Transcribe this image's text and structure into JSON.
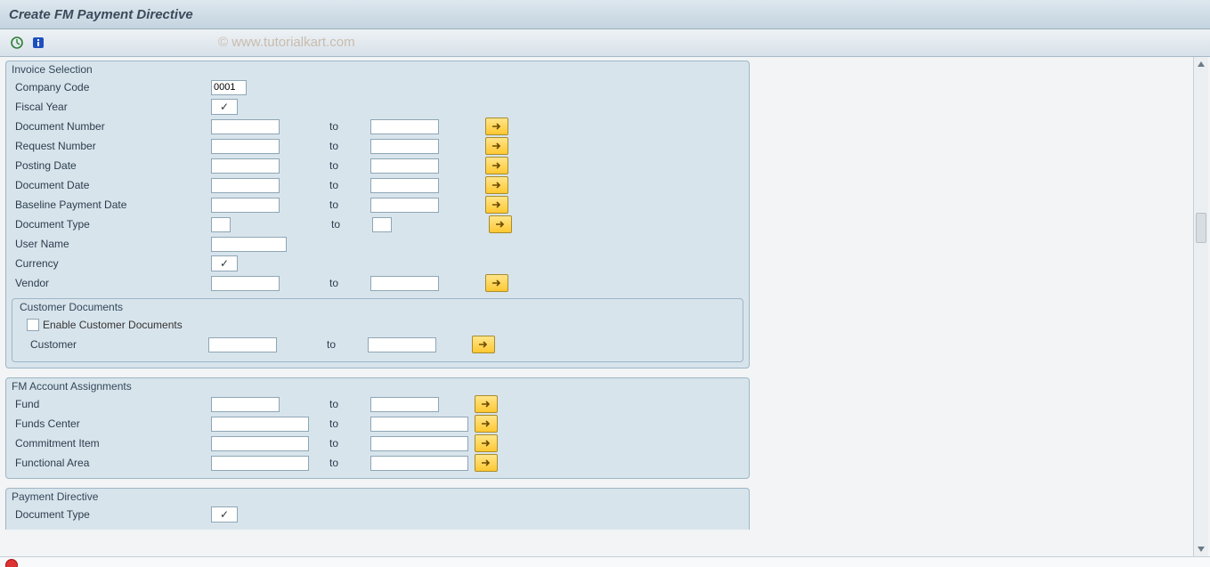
{
  "title": "Create FM Payment Directive",
  "watermark": "© www.tutorialkart.com",
  "toolbar": {
    "execute_icon": "execute-icon",
    "info_icon": "info-icon"
  },
  "groups": {
    "invoice_selection": {
      "title": "Invoice Selection",
      "fields": {
        "company_code": {
          "label": "Company Code",
          "value": "0001"
        },
        "fiscal_year": {
          "label": "Fiscal Year",
          "checked": true
        },
        "doc_number": {
          "label": "Document Number",
          "to": "to"
        },
        "req_number": {
          "label": "Request Number",
          "to": "to"
        },
        "posting_date": {
          "label": "Posting Date",
          "to": "to"
        },
        "doc_date": {
          "label": "Document Date",
          "to": "to"
        },
        "baseline_date": {
          "label": "Baseline Payment Date",
          "to": "to"
        },
        "doc_type": {
          "label": "Document Type",
          "to": "to"
        },
        "user_name": {
          "label": "User Name"
        },
        "currency": {
          "label": "Currency",
          "checked": true
        },
        "vendor": {
          "label": "Vendor",
          "to": "to"
        }
      },
      "customer_documents": {
        "title": "Customer Documents",
        "enable_label": "Enable Customer Documents",
        "customer": {
          "label": "Customer",
          "to": "to"
        }
      }
    },
    "fm_account": {
      "title": "FM Account Assignments",
      "fields": {
        "fund": {
          "label": "Fund",
          "to": "to"
        },
        "funds_center": {
          "label": "Funds Center",
          "to": "to"
        },
        "commitment": {
          "label": "Commitment Item",
          "to": "to"
        },
        "func_area": {
          "label": "Functional Area",
          "to": "to"
        }
      }
    },
    "payment_directive": {
      "title": "Payment Directive",
      "fields": {
        "doc_type": {
          "label": "Document Type",
          "checked": true
        }
      }
    }
  },
  "icons": {
    "arrow_right": "arrow-right-icon",
    "scroll_up": "scroll-up-icon",
    "scroll_down": "scroll-down-icon",
    "stop": "stop-icon"
  },
  "status": {
    "text": ""
  }
}
